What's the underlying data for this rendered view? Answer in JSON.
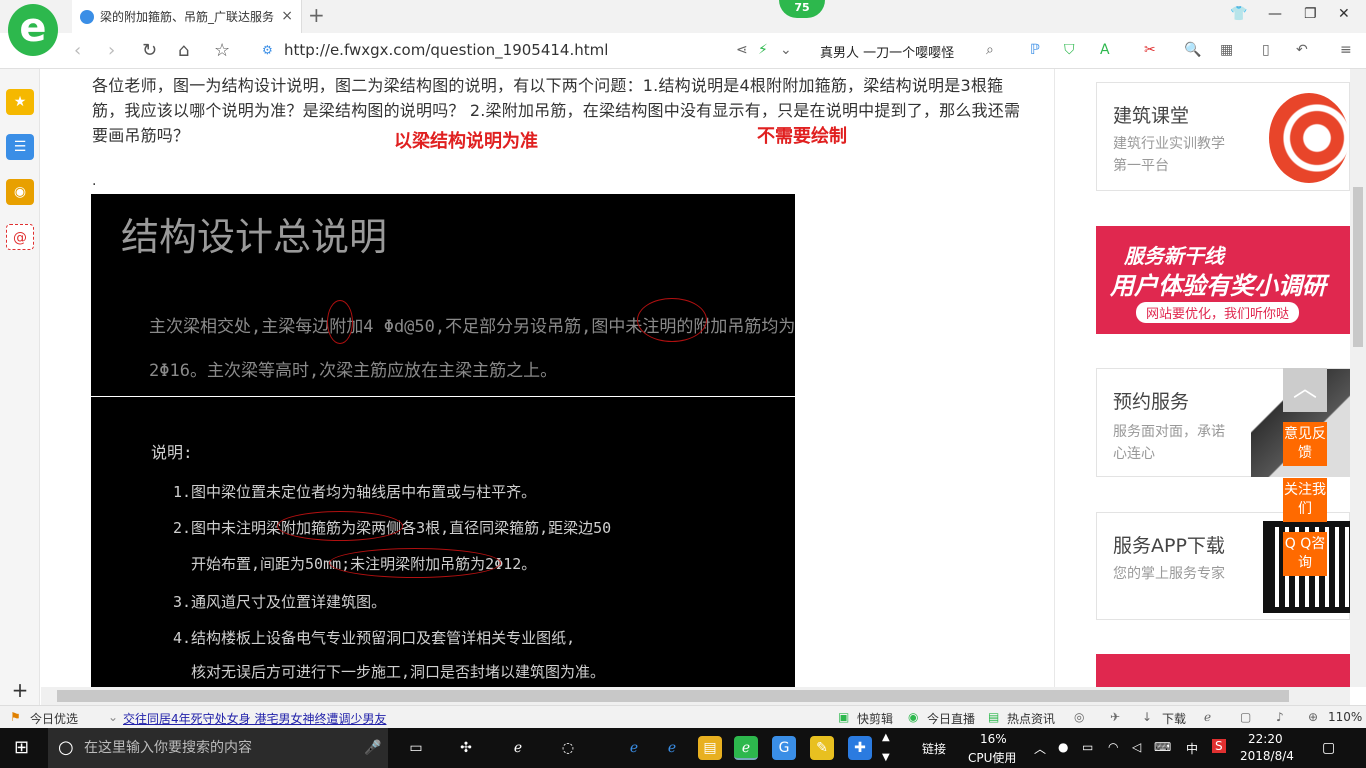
{
  "browser": {
    "tab_title": "梁的附加箍筋、吊筋_广联达服务",
    "tab_close": "×",
    "new_tab": "+",
    "badge": "75",
    "url": "http://e.fwxgx.com/question_1905414.html",
    "search_text": "真男人 一刀一个嘤嘤怪"
  },
  "question": {
    "text": "各位老师，图一为结构设计说明，图二为梁结构图的说明，有以下两个问题：1.结构说明是4根附附加箍筋，梁结构说明是3根箍筋，我应该以哪个说明为准？是梁结构图的说明吗？ 2.梁附加吊筋，在梁结构图中没有显示有，只是在说明中提到了，那么我还需要画吊筋吗？",
    "answer1": "以梁结构说明为准",
    "answer2": "不需要绘制",
    "dot": "."
  },
  "image1": {
    "title": "结构设计总说明",
    "line1": "主次梁相交处,主梁每边附加4 Φd@50,不足部分另设吊筋,图中未注明的附加吊筋均为",
    "line2": "2Φ16。主次梁等高时,次梁主筋应放在主梁主筋之上。"
  },
  "image2": {
    "heading": "说明:",
    "item1": "1.图中梁位置未定位者均为轴线居中布置或与柱平齐。",
    "item2a": "2.图中未注明梁附加箍筋为梁两侧各3根,直径同梁箍筋,距梁边50",
    "item2b": "开始布置,间距为50mm;未注明梁附加吊筋为2Φ12。",
    "item3": "3.通风道尺寸及位置详建筑图。",
    "item4a": "4.结构楼板上设备电气专业预留洞口及套管详相关专业图纸,",
    "item4b": "核对无误后方可进行下一步施工,洞口是否封堵以建筑图为准。"
  },
  "right_cards": {
    "card1_title": "建筑课堂",
    "card1_desc": "建筑行业实训教学第一平台",
    "banner_title": "服务新干线",
    "banner_sub": "用户体验有奖小调研",
    "banner_tag": "网站要优化，我们听你哒",
    "card2_title": "预约服务",
    "card2_desc": "服务面对面，承诺心连心",
    "card3_title": "服务APP下载",
    "card3_desc": "您的掌上服务专家"
  },
  "floating": {
    "top": "︿",
    "feedback": "意见反馈",
    "follow": "关注我们",
    "qq": "Q Q咨询"
  },
  "statusbar": {
    "left1": "今日优选",
    "news": "交往同居4年死守处女身 港宅男女神终遭调少男友",
    "kuaijian": "快剪辑",
    "live": "今日直播",
    "hot": "热点资讯",
    "download": "下载",
    "zoom": "110%"
  },
  "taskbar": {
    "search_placeholder": "在这里输入你要搜索的内容",
    "link": "链接",
    "cpu_pct": "16%",
    "cpu_label": "CPU使用",
    "ime": "中",
    "time": "22:20",
    "date": "2018/8/4"
  },
  "colors": {
    "accent": "#2db84d",
    "answer_red": "#e02020",
    "float_orange": "#ff6a00"
  }
}
